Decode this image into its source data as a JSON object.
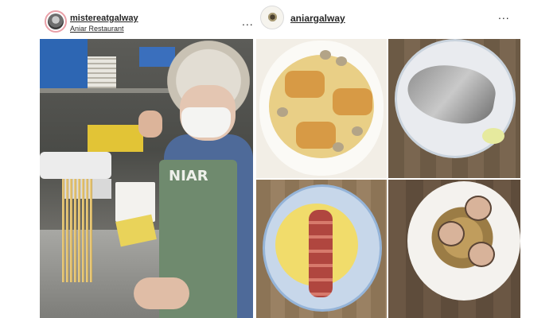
{
  "posts": {
    "left": {
      "username": "mistereatgalway",
      "subtitle": "Aniar Restaurant",
      "more_label": "...",
      "photo": {
        "apron_text": "NIAR"
      }
    },
    "right": {
      "username": "aniargalway",
      "more_label": "..."
    }
  },
  "colors": {
    "text": "#262626",
    "avatar_ring": "#e9a0a8",
    "border": "#dbdbdb"
  },
  "icons": {
    "more": "more-horizontal-icon"
  }
}
